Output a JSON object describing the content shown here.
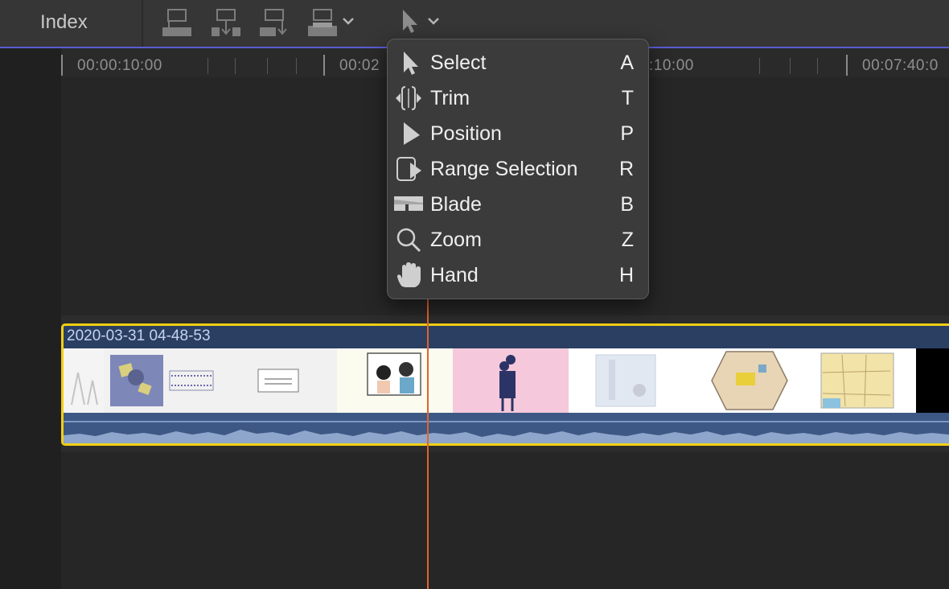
{
  "toolbar": {
    "index_label": "Index",
    "tools": [
      "connect-clip-icon",
      "insert-clip-icon",
      "append-clip-icon",
      "overwrite-clip-icon"
    ],
    "tool_menu_icon": "arrow-cursor-icon"
  },
  "ruler": {
    "timecodes": [
      "00:00:10:00",
      "00:02",
      ":10:00",
      "00:07:40:0"
    ]
  },
  "tool_menu": {
    "items": [
      {
        "label": "Select",
        "shortcut": "A",
        "icon": "select-arrow-icon"
      },
      {
        "label": "Trim",
        "shortcut": "T",
        "icon": "trim-icon"
      },
      {
        "label": "Position",
        "shortcut": "P",
        "icon": "position-arrow-icon"
      },
      {
        "label": "Range Selection",
        "shortcut": "R",
        "icon": "range-selection-icon"
      },
      {
        "label": "Blade",
        "shortcut": "B",
        "icon": "blade-icon"
      },
      {
        "label": "Zoom",
        "shortcut": "Z",
        "icon": "magnifier-icon"
      },
      {
        "label": "Hand",
        "shortcut": "H",
        "icon": "hand-icon"
      }
    ]
  },
  "clip": {
    "title": "2020-03-31 04-48-53"
  },
  "colors": {
    "accent": "#f2cf14",
    "playhead": "#e0642c",
    "toolbar_underline": "#5b5cd6",
    "clip_header": "#2b3f63",
    "audio": "#3d5884"
  }
}
